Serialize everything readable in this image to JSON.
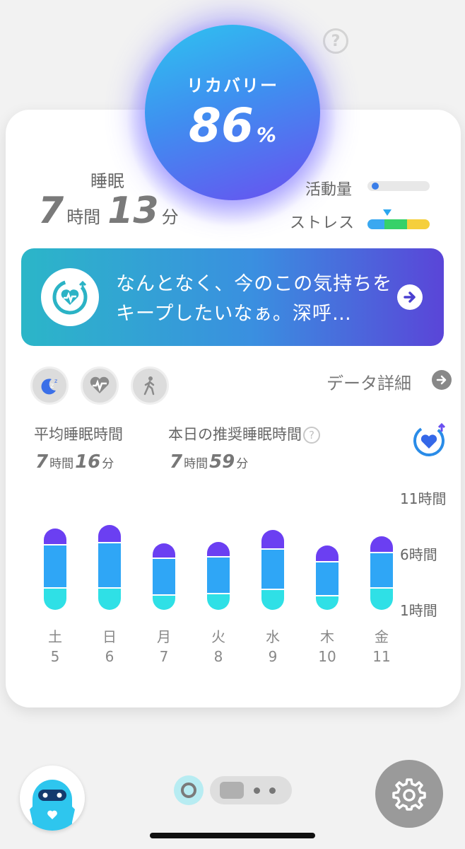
{
  "recovery": {
    "label": "リカバリー",
    "value": "86",
    "unit": "%"
  },
  "sleep": {
    "title": "睡眠",
    "hours": "7",
    "hours_unit": "時間",
    "minutes": "13",
    "minutes_unit": "分"
  },
  "activity": {
    "label": "活動量",
    "level": 0.05
  },
  "stress": {
    "label": "ストレス",
    "colors": [
      "#3aa8f0",
      "#37d169",
      "#f5cf3c"
    ]
  },
  "banner": {
    "message": "なんとなく、今のこの気持ちをキープしたいなぁ。深呼…",
    "icon": "heart-pulse-upload-icon",
    "arrow_icon": "arrow-right-icon"
  },
  "tabs": [
    {
      "name": "sleep",
      "icon": "moon-zz-icon"
    },
    {
      "name": "heart",
      "icon": "heart-pulse-icon"
    },
    {
      "name": "walk",
      "icon": "walking-person-icon"
    }
  ],
  "data_link": {
    "label": "データ詳細"
  },
  "stats": {
    "avg": {
      "label": "平均睡眠時間",
      "hours": "7",
      "hours_unit": "時間",
      "minutes": "16",
      "minutes_unit": "分"
    },
    "recommended": {
      "label": "本日の推奨睡眠時間",
      "hours": "7",
      "hours_unit": "時間",
      "minutes": "59",
      "minutes_unit": "分"
    }
  },
  "chart_data": {
    "type": "bar",
    "stacked": true,
    "categories": [
      "土",
      "日",
      "月",
      "火",
      "水",
      "木",
      "金"
    ],
    "dates": [
      "5",
      "6",
      "7",
      "8",
      "9",
      "10",
      "11"
    ],
    "y_ticks": [
      "11時間",
      "6時間",
      "1時間"
    ],
    "ylim": [
      0,
      11
    ],
    "series": [
      {
        "color": "#2fe0e6",
        "values": [
          1.6,
          1.6,
          1.1,
          1.2,
          1.5,
          1.0,
          1.6
        ]
      },
      {
        "color": "#2fa6f6",
        "values": [
          3.3,
          3.5,
          2.8,
          2.8,
          3.1,
          2.6,
          2.7
        ]
      },
      {
        "color": "#6b3ff2",
        "values": [
          1.3,
          1.4,
          1.2,
          1.2,
          1.5,
          1.3,
          1.3
        ]
      }
    ]
  },
  "footer": {
    "avatar_icon": "mascot-avatar-icon",
    "settings_icon": "gear-icon"
  }
}
